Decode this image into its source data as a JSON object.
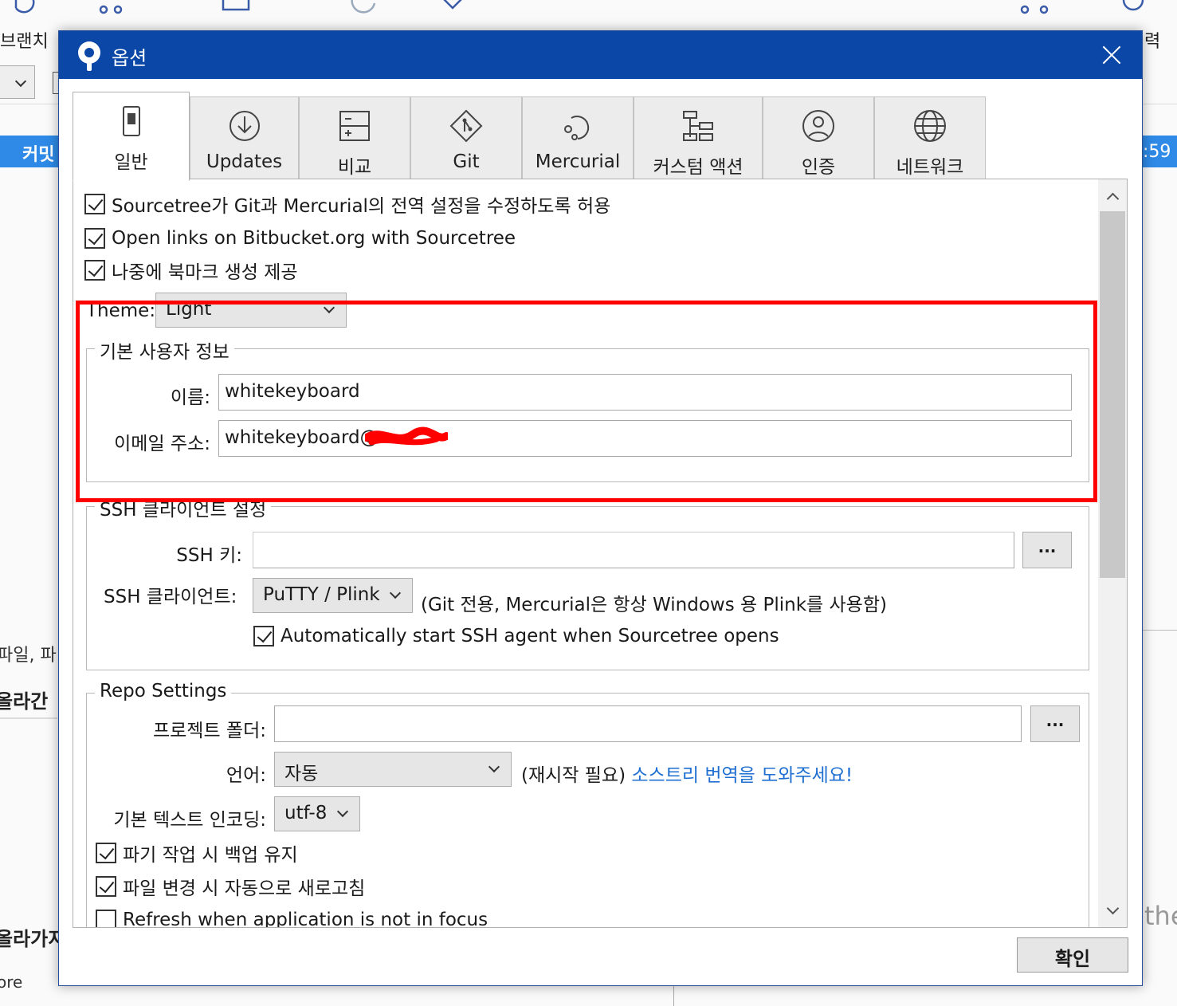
{
  "background": {
    "toolbar_label_branch": "브랜치",
    "toolbar_label_right": "력",
    "commit_label": "커밋",
    "commit_time": ":59",
    "file_label": "파일, 파",
    "staged_label": "올라간",
    "staged2_label": "올라가지",
    "bottom_fragment": "ore",
    "right_fragment": "the"
  },
  "dialog": {
    "title": "옵션",
    "tabs": [
      {
        "label": "일반",
        "icon": "settings-switch-icon",
        "active": true
      },
      {
        "label": "Updates",
        "icon": "download-circle-icon",
        "active": false
      },
      {
        "label": "비교",
        "icon": "diff-icon",
        "active": false
      },
      {
        "label": "Git",
        "icon": "git-icon",
        "active": false
      },
      {
        "label": "Mercurial",
        "icon": "mercurial-icon",
        "active": false
      },
      {
        "label": "커스텀 액션",
        "icon": "custom-actions-icon",
        "active": false
      },
      {
        "label": "인증",
        "icon": "user-icon",
        "active": false
      },
      {
        "label": "네트워크",
        "icon": "globe-icon",
        "active": false
      }
    ],
    "general": {
      "allow_modify_global": {
        "label": "Sourcetree가 Git과 Mercurial의 전역 설정을 수정하도록 허용",
        "checked": true
      },
      "open_bitbucket_links": {
        "label": "Open links on Bitbucket.org with Sourcetree",
        "checked": true
      },
      "offer_bookmarks": {
        "label": "나중에 북마크 생성 제공",
        "checked": true
      },
      "theme": {
        "label": "Theme:",
        "value": "Light"
      },
      "user_info": {
        "title": "기본 사용자 정보",
        "name_label": "이름:",
        "name_value": "whitekeyboard",
        "email_label": "이메일 주소:",
        "email_value": "whitekeyboard@"
      },
      "ssh": {
        "title": "SSH 클라이언트 설정",
        "key_label": "SSH 키:",
        "key_value": "",
        "browse": "...",
        "client_label": "SSH 클라이언트:",
        "client_value": "PuTTY / Plink",
        "client_note": "(Git 전용, Mercurial은 항상 Windows 용 Plink를 사용함)",
        "auto_agent": {
          "label": "Automatically start SSH agent when Sourcetree opens",
          "checked": true
        }
      },
      "repo": {
        "title": "Repo Settings",
        "project_folder_label": "프로젝트 폴더:",
        "project_folder_value": "",
        "browse": "...",
        "language_label": "언어:",
        "language_value": "자동",
        "language_note": "(재시작 필요)",
        "translate_link": "소스트리 번역을 도와주세요!",
        "encoding_label": "기본 텍스트 인코딩:",
        "encoding_value": "utf-8",
        "keep_backup": {
          "label": "파기 작업 시 백업 유지",
          "checked": true
        },
        "auto_refresh": {
          "label": "파일 변경 시 자동으로 새로고침",
          "checked": true
        },
        "refresh_unfocused": {
          "label": "Refresh when application is not in focus",
          "checked": false
        }
      }
    },
    "ok_button": "확인"
  },
  "colors": {
    "titlebar": "#0a47a7",
    "highlight": "#ff0000",
    "link": "#1e6fd1",
    "commit_bar": "#2e8ae6"
  }
}
